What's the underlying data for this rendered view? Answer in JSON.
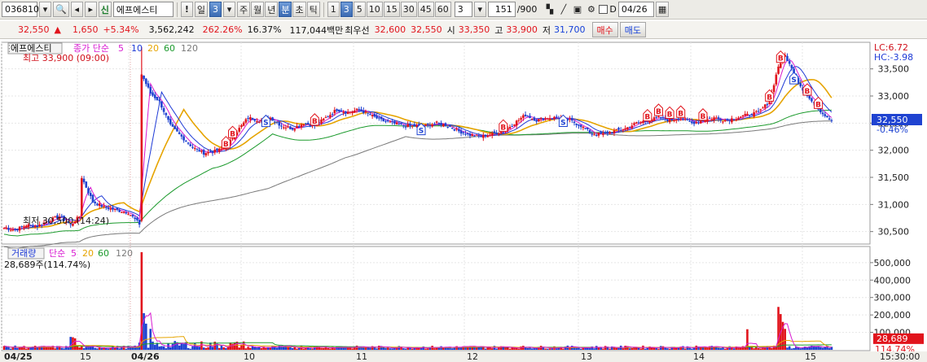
{
  "toolbar": {
    "code": "036810",
    "badge": "신",
    "name": "에프에스티",
    "excl": "!",
    "period_first": "일",
    "period_num": "3",
    "tabs": [
      "주",
      "월",
      "년",
      "분",
      "초",
      "틱"
    ],
    "tab_selected": "분",
    "minute_options": [
      "1",
      "3",
      "5",
      "10",
      "15",
      "30",
      "45",
      "60"
    ],
    "minute_selected": "3",
    "count_value": "3",
    "range_value": "151",
    "range_total": "/900",
    "date_checkbox_label": "D",
    "date_value": "04/26"
  },
  "info": {
    "price": "32,550",
    "arrow": "▲",
    "change": "1,650",
    "change_pct": "+5.34%",
    "volume": "3,562,242",
    "vol_pct": "262.26%",
    "turnover": "16.37%",
    "amount": "117,044백만",
    "best_label": "최우선",
    "ask": "32,600",
    "bid": "32,550",
    "open_label": "시",
    "open": "33,350",
    "high_label": "고",
    "high": "33,900",
    "low_label": "저",
    "low": "31,700",
    "buy_button": "매수",
    "sell_button": "매도"
  },
  "price_panel": {
    "name": "에프에스티",
    "legend_prefix": "종가 단순",
    "ma_periods": [
      "5",
      "10",
      "20",
      "60",
      "120"
    ],
    "high_note": "최고 33,900 (09:00)",
    "low_note": "최저 30,500 (14:24)",
    "lc": "LC:6.72",
    "hc": "HC:-3.98",
    "last_price": "32,550",
    "last_pct": "-0.46%",
    "y_ticks": [
      "33,500",
      "33,000",
      "32,500",
      "32,000",
      "31,500",
      "31,000",
      "30,500"
    ]
  },
  "volume_panel": {
    "label": "거래량",
    "legend_prefix": "단순",
    "ma_periods": [
      "5",
      "20",
      "60",
      "120"
    ],
    "note": "28,689주(114.74%)",
    "last_vol": "28,689",
    "last_pct": "114.74%",
    "y_ticks": [
      "500,000",
      "400,000",
      "300,000",
      "200,000",
      "100,000"
    ]
  },
  "x_axis": {
    "labels": [
      "04/25",
      "15",
      "04/26",
      "10",
      "11",
      "12",
      "13",
      "14",
      "15"
    ],
    "time_label": "15:30:00"
  },
  "colors": {
    "up": "#e1141c",
    "down": "#1f43d1",
    "ma5": "#d81bd1",
    "ma10": "#1e3ad6",
    "ma20": "#e6a400",
    "ma60": "#1b9a2c",
    "ma120": "#7a7a7a"
  },
  "chart_data": {
    "type": "candlestick",
    "price_axis": {
      "min": 30300,
      "max": 33900
    },
    "volume_axis": {
      "min": 0,
      "max": 560000
    },
    "anchors": [
      [
        0,
        30570
      ],
      [
        5,
        30530
      ],
      [
        10,
        30620
      ],
      [
        15,
        30600
      ],
      [
        20,
        30700
      ],
      [
        25,
        30780
      ],
      [
        30,
        30620
      ],
      [
        34,
        30780
      ],
      [
        35,
        31500
      ],
      [
        40,
        31050
      ],
      [
        45,
        30950
      ],
      [
        50,
        30900
      ],
      [
        56,
        30850
      ],
      [
        61,
        30640
      ],
      [
        62,
        33400
      ],
      [
        66,
        33050
      ],
      [
        70,
        32900
      ],
      [
        75,
        32450
      ],
      [
        80,
        32250
      ],
      [
        85,
        32050
      ],
      [
        90,
        31950
      ],
      [
        95,
        31980
      ],
      [
        100,
        32050
      ],
      [
        105,
        32350
      ],
      [
        110,
        32600
      ],
      [
        115,
        32550
      ],
      [
        120,
        32600
      ],
      [
        125,
        32450
      ],
      [
        130,
        32400
      ],
      [
        135,
        32500
      ],
      [
        140,
        32450
      ],
      [
        145,
        32600
      ],
      [
        150,
        32750
      ],
      [
        155,
        32700
      ],
      [
        160,
        32750
      ],
      [
        165,
        32650
      ],
      [
        170,
        32550
      ],
      [
        175,
        32500
      ],
      [
        180,
        32450
      ],
      [
        185,
        32450
      ],
      [
        190,
        32450
      ],
      [
        195,
        32500
      ],
      [
        200,
        32450
      ],
      [
        205,
        32350
      ],
      [
        210,
        32280
      ],
      [
        215,
        32250
      ],
      [
        220,
        32300
      ],
      [
        225,
        32350
      ],
      [
        230,
        32500
      ],
      [
        235,
        32650
      ],
      [
        240,
        32550
      ],
      [
        245,
        32600
      ],
      [
        250,
        32600
      ],
      [
        255,
        32550
      ],
      [
        260,
        32450
      ],
      [
        265,
        32300
      ],
      [
        270,
        32300
      ],
      [
        275,
        32350
      ],
      [
        280,
        32400
      ],
      [
        285,
        32500
      ],
      [
        290,
        32550
      ],
      [
        295,
        32600
      ],
      [
        300,
        32550
      ],
      [
        305,
        32600
      ],
      [
        310,
        32500
      ],
      [
        315,
        32550
      ],
      [
        320,
        32600
      ],
      [
        325,
        32550
      ],
      [
        330,
        32600
      ],
      [
        335,
        32650
      ],
      [
        340,
        32700
      ],
      [
        345,
        32900
      ],
      [
        349,
        33550
      ],
      [
        352,
        33750
      ],
      [
        355,
        33500
      ],
      [
        358,
        33250
      ],
      [
        362,
        33000
      ],
      [
        366,
        32800
      ],
      [
        370,
        32650
      ],
      [
        373,
        32550
      ]
    ],
    "volume_spikes": [
      [
        30,
        74000
      ],
      [
        31,
        72000
      ],
      [
        32,
        66000
      ],
      [
        62,
        560000
      ],
      [
        63,
        210000
      ],
      [
        64,
        150000
      ],
      [
        66,
        120000
      ],
      [
        335,
        118000
      ],
      [
        349,
        246000
      ],
      [
        350,
        205000
      ],
      [
        351,
        160000
      ],
      [
        352,
        120000
      ]
    ],
    "signals": [
      {
        "kind": "B",
        "at": 100
      },
      {
        "kind": "B",
        "at": 103
      },
      {
        "kind": "S",
        "at": 118
      },
      {
        "kind": "B",
        "at": 140
      },
      {
        "kind": "S",
        "at": 188
      },
      {
        "kind": "B",
        "at": 225
      },
      {
        "kind": "S",
        "at": 252
      },
      {
        "kind": "B",
        "at": 290
      },
      {
        "kind": "B",
        "at": 295
      },
      {
        "kind": "B",
        "at": 300
      },
      {
        "kind": "B",
        "at": 305
      },
      {
        "kind": "B",
        "at": 315
      },
      {
        "kind": "B",
        "at": 345
      },
      {
        "kind": "B",
        "at": 350
      },
      {
        "kind": "S",
        "at": 356
      },
      {
        "kind": "B",
        "at": 362
      },
      {
        "kind": "B",
        "at": 367
      }
    ]
  }
}
